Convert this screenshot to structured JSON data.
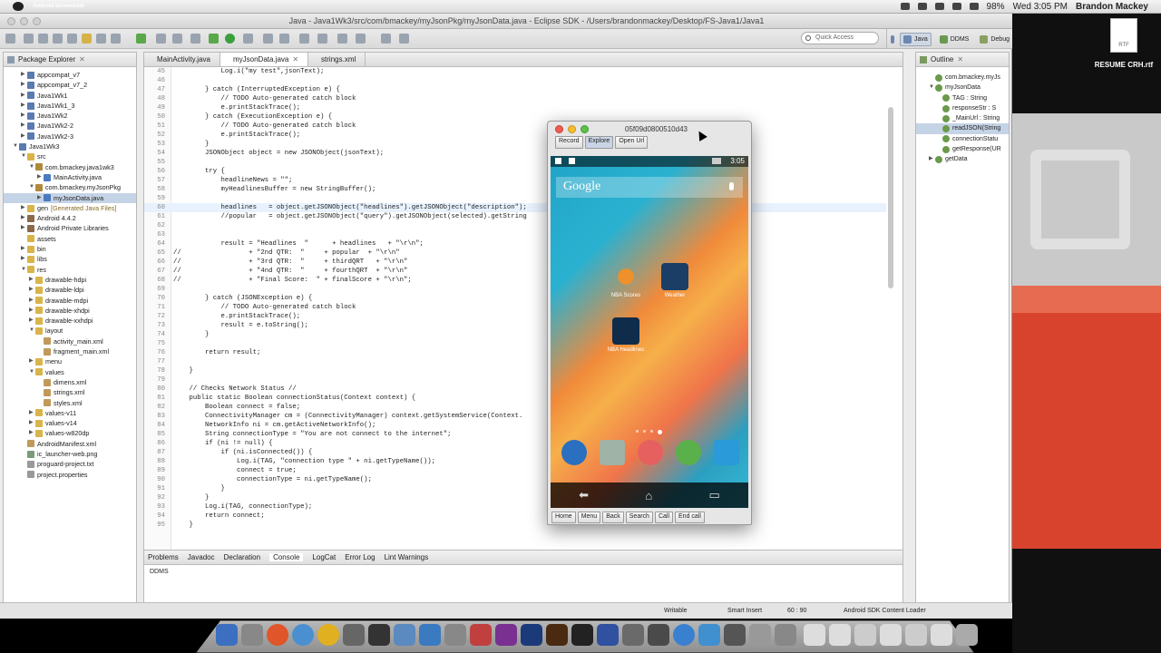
{
  "menubar": {
    "app_name": "Android Screencast",
    "battery": "98%",
    "clock": "Wed 3:05 PM",
    "user": "Brandon Mackey"
  },
  "window": {
    "title": "Java - Java1Wk3/src/com/bmackey/myJsonPkg/myJsonData.java - Eclipse SDK - /Users/brandonmackey/Desktop/FS-Java1/Java1"
  },
  "toolbar": {
    "quick_access_placeholder": "Quick Access",
    "perspectives": [
      "Java",
      "DDMS",
      "Debug"
    ]
  },
  "package_explorer": {
    "title": "Package Explorer",
    "items": [
      {
        "label": "appcompat_v7",
        "indent": 1,
        "arrow": "▶",
        "kind": "project"
      },
      {
        "label": "appcompat_v7_2",
        "indent": 1,
        "arrow": "▶",
        "kind": "project"
      },
      {
        "label": "Java1Wk1",
        "indent": 1,
        "arrow": "▶",
        "kind": "project"
      },
      {
        "label": "Java1Wk1_3",
        "indent": 1,
        "arrow": "▶",
        "kind": "project"
      },
      {
        "label": "Java1Wk2",
        "indent": 1,
        "arrow": "▶",
        "kind": "project"
      },
      {
        "label": "Java1Wk2-2",
        "indent": 1,
        "arrow": "▶",
        "kind": "project"
      },
      {
        "label": "Java1Wk2-3",
        "indent": 1,
        "arrow": "▶",
        "kind": "project"
      },
      {
        "label": "Java1Wk3",
        "indent": 0,
        "arrow": "▼",
        "kind": "project"
      },
      {
        "label": "src",
        "indent": 1,
        "arrow": "▼",
        "kind": "folder"
      },
      {
        "label": "com.bmackey.java1wk3",
        "indent": 2,
        "arrow": "▼",
        "kind": "package"
      },
      {
        "label": "MainActivity.java",
        "indent": 3,
        "arrow": "▶",
        "kind": "java"
      },
      {
        "label": "com.bmackey.myJsonPkg",
        "indent": 2,
        "arrow": "▼",
        "kind": "package"
      },
      {
        "label": "myJsonData.java",
        "indent": 3,
        "arrow": "▶",
        "kind": "java",
        "selected": true
      },
      {
        "label": "gen",
        "suffix": "[Generated Java Files]",
        "indent": 1,
        "arrow": "▶",
        "kind": "folder"
      },
      {
        "label": "Android 4.4.2",
        "indent": 1,
        "arrow": "▶",
        "kind": "lib"
      },
      {
        "label": "Android Private Libraries",
        "indent": 1,
        "arrow": "▶",
        "kind": "lib"
      },
      {
        "label": "assets",
        "indent": 1,
        "arrow": "",
        "kind": "folder"
      },
      {
        "label": "bin",
        "indent": 1,
        "arrow": "▶",
        "kind": "folder"
      },
      {
        "label": "libs",
        "indent": 1,
        "arrow": "▶",
        "kind": "folder"
      },
      {
        "label": "res",
        "indent": 1,
        "arrow": "▼",
        "kind": "folder"
      },
      {
        "label": "drawable-hdpi",
        "indent": 2,
        "arrow": "▶",
        "kind": "folder"
      },
      {
        "label": "drawable-ldpi",
        "indent": 2,
        "arrow": "▶",
        "kind": "folder"
      },
      {
        "label": "drawable-mdpi",
        "indent": 2,
        "arrow": "▶",
        "kind": "folder"
      },
      {
        "label": "drawable-xhdpi",
        "indent": 2,
        "arrow": "▶",
        "kind": "folder"
      },
      {
        "label": "drawable-xxhdpi",
        "indent": 2,
        "arrow": "▶",
        "kind": "folder"
      },
      {
        "label": "layout",
        "indent": 2,
        "arrow": "▼",
        "kind": "folder"
      },
      {
        "label": "activity_main.xml",
        "indent": 3,
        "arrow": "",
        "kind": "xml"
      },
      {
        "label": "fragment_main.xml",
        "indent": 3,
        "arrow": "",
        "kind": "xml"
      },
      {
        "label": "menu",
        "indent": 2,
        "arrow": "▶",
        "kind": "folder"
      },
      {
        "label": "values",
        "indent": 2,
        "arrow": "▼",
        "kind": "folder"
      },
      {
        "label": "dimens.xml",
        "indent": 3,
        "arrow": "",
        "kind": "xml"
      },
      {
        "label": "strings.xml",
        "indent": 3,
        "arrow": "",
        "kind": "xml"
      },
      {
        "label": "styles.xml",
        "indent": 3,
        "arrow": "",
        "kind": "xml"
      },
      {
        "label": "values-v11",
        "indent": 2,
        "arrow": "▶",
        "kind": "folder"
      },
      {
        "label": "values-v14",
        "indent": 2,
        "arrow": "▶",
        "kind": "folder"
      },
      {
        "label": "values-w820dp",
        "indent": 2,
        "arrow": "▶",
        "kind": "folder"
      },
      {
        "label": "AndroidManifest.xml",
        "indent": 1,
        "arrow": "",
        "kind": "xml"
      },
      {
        "label": "ic_launcher-web.png",
        "indent": 1,
        "arrow": "",
        "kind": "img"
      },
      {
        "label": "proguard-project.txt",
        "indent": 1,
        "arrow": "",
        "kind": "file"
      },
      {
        "label": "project.properties",
        "indent": 1,
        "arrow": "",
        "kind": "file"
      }
    ]
  },
  "editor": {
    "tabs": [
      {
        "label": "MainActivity.java",
        "active": false
      },
      {
        "label": "myJsonData.java",
        "active": true
      },
      {
        "label": "strings.xml",
        "active": false
      }
    ],
    "lines": [
      {
        "n": "45",
        "t": "            Log.i(\"my test\",jsonText);"
      },
      {
        "n": "46",
        "t": ""
      },
      {
        "n": "47",
        "t": "        } catch (InterruptedException e) {"
      },
      {
        "n": "48",
        "t": "            // TODO Auto-generated catch block",
        "c": "cm"
      },
      {
        "n": "49",
        "t": "            e.printStackTrace();"
      },
      {
        "n": "50",
        "t": "        } catch (ExecutionException e) {"
      },
      {
        "n": "51",
        "t": "            // TODO Auto-generated catch block",
        "c": "cm"
      },
      {
        "n": "52",
        "t": "            e.printStackTrace();"
      },
      {
        "n": "53",
        "t": "        }"
      },
      {
        "n": "54",
        "t": "        JSONObject object = new JSONObject(jsonText);"
      },
      {
        "n": "55",
        "t": ""
      },
      {
        "n": "56",
        "t": "        try {"
      },
      {
        "n": "57",
        "t": "            headlineNews = \"\";"
      },
      {
        "n": "58",
        "t": "            myHeadlinesBuffer = new StringBuffer();"
      },
      {
        "n": "59",
        "t": ""
      },
      {
        "n": "60",
        "t": "            headlines   = object.getJSONObject(\"headlines\").getJSONObject(\"description\");",
        "hl": true
      },
      {
        "n": "61",
        "t": "            //popular   = object.getJSONObject(\"query\").getJSONObject(selected).getString",
        "c": "cm"
      },
      {
        "n": "62",
        "t": ""
      },
      {
        "n": "63",
        "t": ""
      },
      {
        "n": "64",
        "t": "            result = \"Headlines  \"      + headlines   + \"\\r\\n\";"
      },
      {
        "n": "65",
        "t": "//                 + \"2nd QTR:  \"     + popular  + \"\\r\\n\"",
        "c": "cm"
      },
      {
        "n": "66",
        "t": "//                 + \"3rd QTR:  \"     + thirdQRT   + \"\\r\\n\"",
        "c": "cm"
      },
      {
        "n": "67",
        "t": "//                 + \"4nd QTR:  \"     + fourthQRT  + \"\\r\\n\"",
        "c": "cm"
      },
      {
        "n": "68",
        "t": "//                 + \"Final Score:  \" + finalScore + \"\\r\\n\";",
        "c": "cm"
      },
      {
        "n": "69",
        "t": ""
      },
      {
        "n": "70",
        "t": "        } catch (JSONException e) {"
      },
      {
        "n": "71",
        "t": "            // TODO Auto-generated catch block",
        "c": "cm"
      },
      {
        "n": "72",
        "t": "            e.printStackTrace();"
      },
      {
        "n": "73",
        "t": "            result = e.toString();"
      },
      {
        "n": "74",
        "t": "        }"
      },
      {
        "n": "75",
        "t": ""
      },
      {
        "n": "76",
        "t": "        return result;"
      },
      {
        "n": "77",
        "t": ""
      },
      {
        "n": "78",
        "t": "    }"
      },
      {
        "n": "79",
        "t": ""
      },
      {
        "n": "80",
        "t": "    // Checks Network Status //",
        "c": "cm"
      },
      {
        "n": "81",
        "t": "    public static Boolean connectionStatus(Context context) {"
      },
      {
        "n": "82",
        "t": "        Boolean connect = false;"
      },
      {
        "n": "83",
        "t": "        ConnectivityManager cm = (ConnectivityManager) context.getSystemService(Context."
      },
      {
        "n": "84",
        "t": "        NetworkInfo ni = cm.getActiveNetworkInfo();"
      },
      {
        "n": "85",
        "t": "        String connectionType = \"You are not connect to the internet\";"
      },
      {
        "n": "86",
        "t": "        if (ni != null) {"
      },
      {
        "n": "87",
        "t": "            if (ni.isConnected()) {"
      },
      {
        "n": "88",
        "t": "                Log.i(TAG, \"connection type \" + ni.getTypeName());"
      },
      {
        "n": "89",
        "t": "                connect = true;"
      },
      {
        "n": "90",
        "t": "                connectionType = ni.getTypeName();"
      },
      {
        "n": "91",
        "t": "            }"
      },
      {
        "n": "92",
        "t": "        }"
      },
      {
        "n": "93",
        "t": "        Log.i(TAG, connectionType);"
      },
      {
        "n": "94",
        "t": "        return connect;"
      },
      {
        "n": "95",
        "t": "    }"
      }
    ]
  },
  "bottom_panel": {
    "tabs": [
      "Problems",
      "Javadoc",
      "Declaration",
      "Console",
      "LogCat",
      "Error Log",
      "Lint Warnings"
    ],
    "active_tab": "Console",
    "console_text": "DDMS"
  },
  "outline": {
    "title": "Outline",
    "items": [
      {
        "label": "com.bmackey.myJs",
        "indent": 1,
        "arrow": ""
      },
      {
        "label": "myJsonData",
        "indent": 1,
        "arrow": "▼"
      },
      {
        "label": "TAG : String",
        "indent": 2,
        "arrow": ""
      },
      {
        "label": "responseStr : S",
        "indent": 2,
        "arrow": ""
      },
      {
        "label": "_MainUrl : String",
        "indent": 2,
        "arrow": ""
      },
      {
        "label": "readJSON(String",
        "indent": 2,
        "arrow": "",
        "selected": true
      },
      {
        "label": "connectionStatu",
        "indent": 2,
        "arrow": ""
      },
      {
        "label": "getResponse(UR",
        "indent": 2,
        "arrow": ""
      },
      {
        "label": "getData",
        "indent": 1,
        "arrow": "▶"
      }
    ]
  },
  "statusbar": {
    "writable": "Writable",
    "insert_mode": "Smart Insert",
    "position": "60 : 90",
    "loader": "Android SDK Content Loader"
  },
  "emulator": {
    "title": "05f09d0800510d43",
    "tools": [
      "Record",
      "Explore",
      "Open Url"
    ],
    "active_tool": "Explore",
    "status_clock": "3:05",
    "search_label": "Google",
    "apps": [
      {
        "label": "NBA Scores",
        "color": "#e47a1e"
      },
      {
        "label": "Weather",
        "color": "#2f8fd8"
      },
      {
        "label": "NBA Headlines",
        "color": "#2a7fc4"
      }
    ],
    "buttons": [
      "Home",
      "Menu",
      "Back",
      "Search",
      "Call",
      "End call"
    ]
  },
  "desktop": {
    "file_label": "RESUME CRH.rtf",
    "file_type": "RTF"
  }
}
